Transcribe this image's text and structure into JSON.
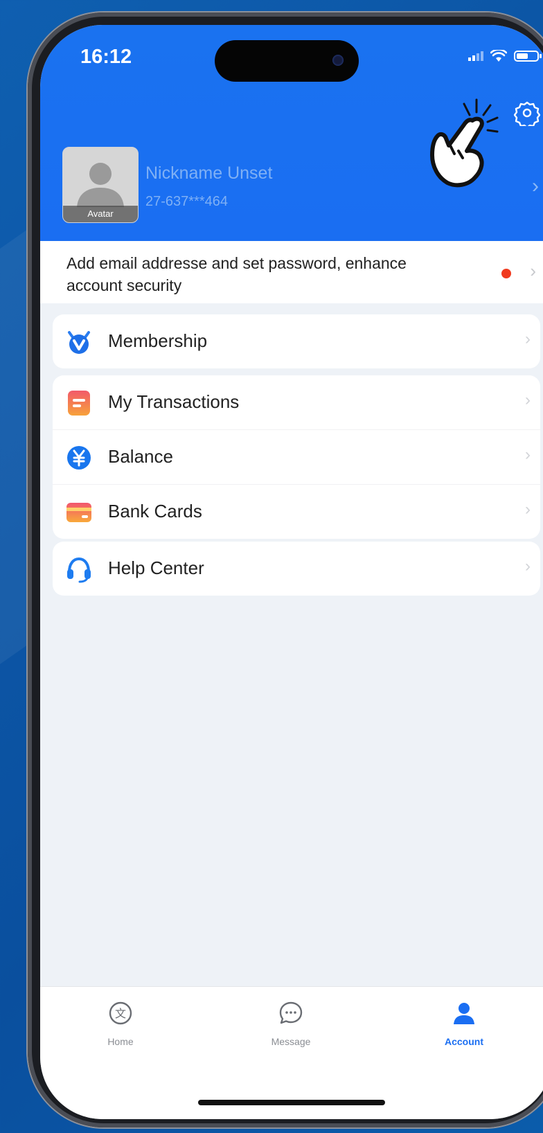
{
  "status": {
    "time": "16:12"
  },
  "profile": {
    "nickname": "Nickname Unset",
    "phone": "27-637***464",
    "avatar_label": "Avatar"
  },
  "security": {
    "text": "Add email addresse and set password, enhance account security"
  },
  "menu": {
    "membership": {
      "label": "Membership",
      "icon": "membership-icon"
    },
    "transactions": {
      "label": "My Transactions",
      "icon": "transactions-icon"
    },
    "balance": {
      "label": "Balance",
      "icon": "yen-icon"
    },
    "bank_cards": {
      "label": "Bank Cards",
      "icon": "card-icon"
    },
    "help_center": {
      "label": "Help Center",
      "icon": "headset-icon"
    }
  },
  "tabs": [
    {
      "label": "Home",
      "icon": "home-icon",
      "active": false
    },
    {
      "label": "Message",
      "icon": "message-icon",
      "active": false
    },
    {
      "label": "Account",
      "icon": "account-icon",
      "active": true
    }
  ],
  "colors": {
    "header": "#1a6ef2",
    "accent": "#1a6ef2",
    "notification_dot": "#f03a1f"
  }
}
